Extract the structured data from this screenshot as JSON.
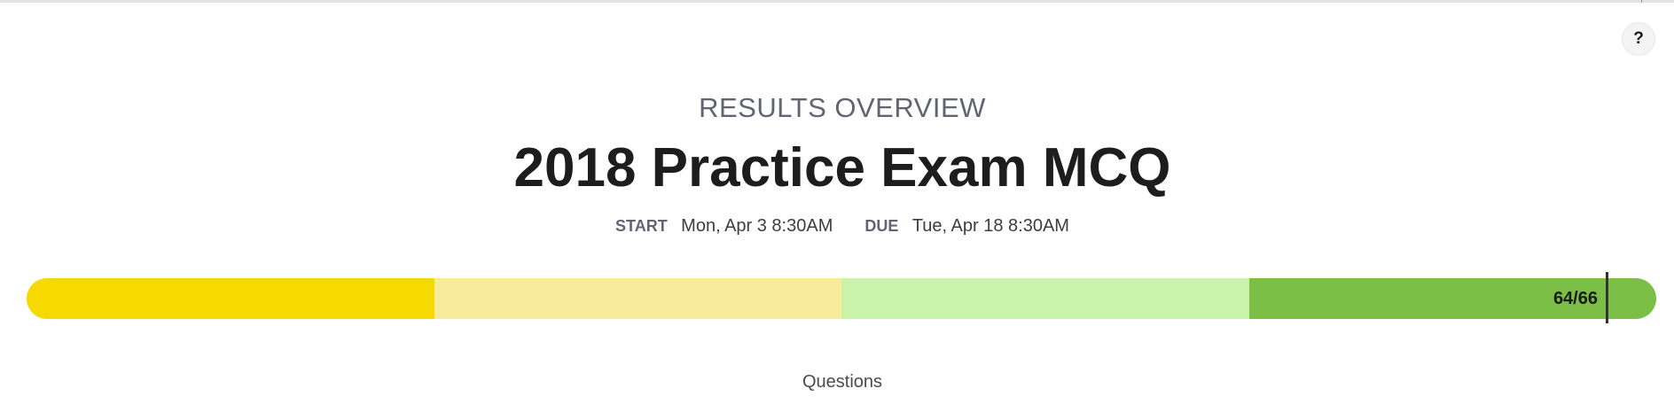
{
  "header": {
    "help_label": "?"
  },
  "overview": {
    "overline": "RESULTS OVERVIEW",
    "title": "2018 Practice Exam MCQ",
    "start_label": "START",
    "start_value": "Mon, Apr 3 8:30AM",
    "due_label": "DUE",
    "due_value": "Tue, Apr 18 8:30AM"
  },
  "progress": {
    "score_text": "64/66",
    "score": 64,
    "total": 66,
    "segments": [
      {
        "color": "#f6d900"
      },
      {
        "color": "#f9eb9c"
      },
      {
        "color": "#c8f3a8"
      },
      {
        "color": "#7bbf47"
      }
    ]
  },
  "footer": {
    "label": "Questions"
  }
}
